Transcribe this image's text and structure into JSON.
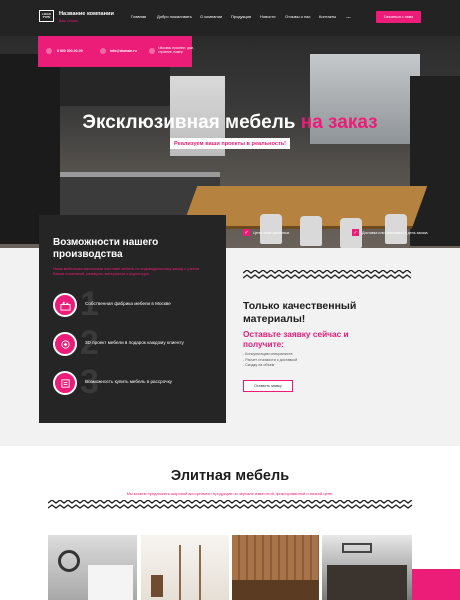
{
  "header": {
    "logo_text": "LOGO TYPE",
    "brand_name": "Название компании",
    "brand_tagline": "Ваш слоган",
    "nav": [
      "Главная",
      "Добро пожаловать",
      "О компании",
      "Продукция",
      "Новости",
      "Отзывы о нас",
      "Контакты"
    ],
    "more": "...",
    "cta": "Связаться с нами"
  },
  "contact_bar": {
    "phone": "8 800 000-00-00",
    "email": "info@domain.ru",
    "address": "г.Москва, проспект, дом, строение, номер"
  },
  "hero": {
    "title_main": "Эксклюзивная мебель",
    "title_accent": "на заказ",
    "subtitle": "Реализуем ваши проекты в реальность!",
    "features": [
      "Цены ниже рыночных",
      "Доставка или самовывоз в день заказа"
    ]
  },
  "capabilities": {
    "title": "Возможности нашего производства",
    "description": "Наша мебельная мастерская изготовит мебель по индивидуальному заказу с учетом Ваших пожеланий, размеров, материалов и фурнитуры.",
    "items": [
      {
        "num": "1",
        "icon": "factory-icon",
        "label": "Собственная фабрика мебели в Москве"
      },
      {
        "num": "2",
        "icon": "design-icon",
        "label": "3D проект мебели в подарок каждому клиенту"
      },
      {
        "num": "3",
        "icon": "installment-icon",
        "label": "Возможность купить мебель в рассрочку"
      }
    ]
  },
  "quality": {
    "title": "Только качественный материалы!",
    "cta_text": "Оставьте заявку сейчас и получите:",
    "list": [
      "- Консультацию специалиста",
      "- Расчет стоимости с доставкой",
      "- Скидку на объем"
    ],
    "button": "Оставить заявку"
  },
  "elite": {
    "title": "Элитная мебель",
    "subtitle": "Мы можем предложить широкий ассортимент продукции по зеркале известной, фиксированной и низкой цене."
  },
  "colors": {
    "accent": "#ec1c79",
    "dark": "#252525",
    "light_bg": "#f2f2f2"
  }
}
